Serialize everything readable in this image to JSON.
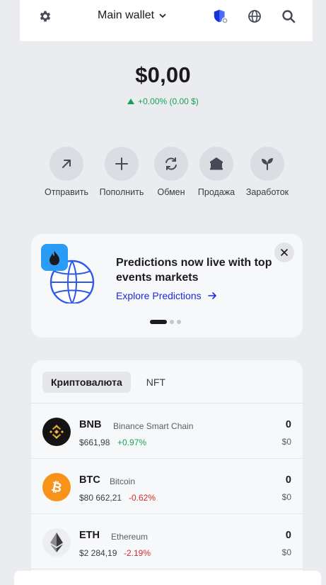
{
  "header": {
    "wallet_name": "Main wallet",
    "icons": [
      "gear-icon",
      "shield-icon",
      "globe-icon",
      "search-icon"
    ]
  },
  "balance": {
    "amount": "$0,00",
    "change": "+0.00% (0.00 $)"
  },
  "actions": [
    {
      "label": "Отправить",
      "icon": "arrow-up-right-icon"
    },
    {
      "label": "Пополнить",
      "icon": "plus-icon"
    },
    {
      "label": "Обмен",
      "icon": "swap-icon"
    },
    {
      "label": "Продажа",
      "icon": "bank-icon"
    },
    {
      "label": "Заработок",
      "icon": "sprout-icon"
    }
  ],
  "promo": {
    "title": "Predictions now live with top events markets",
    "link": "Explore Predictions",
    "slides": 3,
    "active_slide": 1
  },
  "assets": {
    "tabs": [
      {
        "label": "Криптовалюта",
        "active": true
      },
      {
        "label": "NFT",
        "active": false
      }
    ],
    "rows": [
      {
        "symbol": "BNB",
        "network": "Binance Smart Chain",
        "price": "$661,98",
        "change": "+0.97%",
        "direction": "up",
        "amount": "0",
        "value": "$0"
      },
      {
        "symbol": "BTC",
        "network": "Bitcoin",
        "price": "$80 662,21",
        "change": "-0.62%",
        "direction": "down",
        "amount": "0",
        "value": "$0"
      },
      {
        "symbol": "ETH",
        "network": "Ethereum",
        "price": "$2 284,19",
        "change": "-2.19%",
        "direction": "down",
        "amount": "0",
        "value": "$0"
      }
    ]
  },
  "colors": {
    "background": "#ebecef",
    "positive": "#19a05a",
    "negative": "#d62b2b",
    "link": "#1b2ad9",
    "bnb": "#f3ba2f",
    "btc": "#f7931a"
  }
}
